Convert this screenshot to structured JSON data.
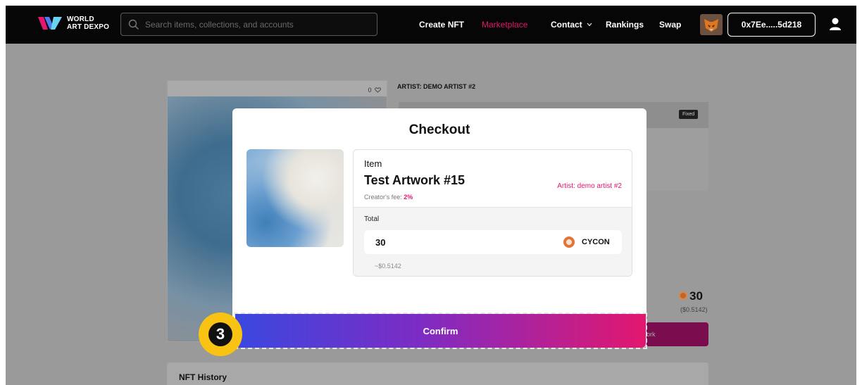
{
  "header": {
    "brand_line1": "WORLD",
    "brand_line2": "ART DEXPO",
    "search_placeholder": "Search items, collections, and accounts",
    "nav": {
      "create": "Create NFT",
      "marketplace": "Marketplace",
      "contact": "Contact",
      "rankings": "Rankings",
      "swap": "Swap"
    },
    "wallet_address": "0x7Ee.....5d218"
  },
  "background_page": {
    "likes": "0",
    "artist_title": "ARTIST: DEMO ARTIST #2",
    "badge": "Fixed",
    "price": "30",
    "price_usd": "($0.5142)",
    "buy_button_label": "ork",
    "history_title": "NFT History"
  },
  "modal": {
    "title": "Checkout",
    "item_label": "Item",
    "item_name": "Test Artwork #15",
    "artist": "Artist: demo artist #2",
    "creator_fee_label": "Creator's fee:",
    "creator_fee_value": "2%",
    "total_label": "Total",
    "total_value": "30",
    "currency": "CYCON",
    "total_usd": "~$0.5142",
    "confirm_label": "Confirm"
  },
  "annotation": {
    "step_number": "3"
  },
  "colors": {
    "accent_pink": "#e4166d",
    "gradient_start": "#3a48e0",
    "gradient_end": "#e3176f",
    "step_badge": "#f9c313"
  }
}
